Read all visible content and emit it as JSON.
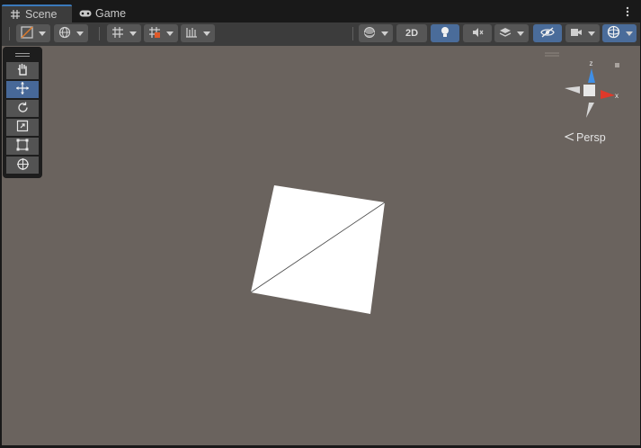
{
  "tabs": [
    {
      "label": "Scene",
      "icon": "grid-hash-icon",
      "active": true
    },
    {
      "label": "Game",
      "icon": "gamepad-icon",
      "active": false
    }
  ],
  "toolbar": {
    "mode_2d_label": "2D",
    "accent_color": "#4a6c9a"
  },
  "tools": [
    {
      "name": "hand-tool",
      "icon": "hand-icon",
      "selected": false
    },
    {
      "name": "move-tool",
      "icon": "move-arrows-icon",
      "selected": true
    },
    {
      "name": "rotate-tool",
      "icon": "rotate-icon",
      "selected": false
    },
    {
      "name": "scale-tool",
      "icon": "scale-icon",
      "selected": false
    },
    {
      "name": "rect-tool",
      "icon": "rect-transform-icon",
      "selected": false
    },
    {
      "name": "transform-tool",
      "icon": "transform-icon",
      "selected": false
    }
  ],
  "gizmo": {
    "y_label": "z",
    "x_label": "x",
    "projection_label": "Persp"
  },
  "scene": {
    "background_color": "#6a635e",
    "object_color": "#ffffff"
  }
}
